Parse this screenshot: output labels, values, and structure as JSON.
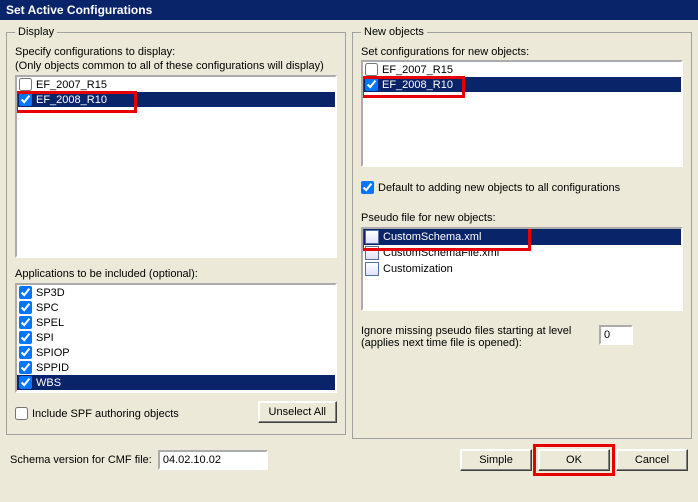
{
  "title": "Set Active Configurations",
  "display": {
    "legend": "Display",
    "specify_label": "Specify configurations to display:",
    "only_common_label": "(Only objects common to all of these configurations will display)",
    "items": [
      {
        "label": "EF_2007_R15",
        "checked": false,
        "selected": false
      },
      {
        "label": "EF_2008_R10",
        "checked": true,
        "selected": true
      }
    ],
    "apps_label": "Applications to be included (optional):",
    "apps": [
      {
        "label": "SP3D",
        "checked": true
      },
      {
        "label": "SPC",
        "checked": true
      },
      {
        "label": "SPEL",
        "checked": true
      },
      {
        "label": "SPI",
        "checked": true
      },
      {
        "label": "SPIOP",
        "checked": true
      },
      {
        "label": "SPPID",
        "checked": true
      },
      {
        "label": "WBS",
        "checked": true,
        "selected": true
      }
    ],
    "include_spf_label": "Include SPF authoring objects",
    "include_spf_checked": false,
    "unselect_all": "Unselect All"
  },
  "newobjects": {
    "legend": "New objects",
    "set_label": "Set configurations for new objects:",
    "items": [
      {
        "label": "EF_2007_R15",
        "checked": false,
        "selected": false
      },
      {
        "label": "EF_2008_R10",
        "checked": true,
        "selected": true
      }
    ],
    "default_add_label": "Default to adding new objects to all configurations",
    "default_add_checked": true,
    "pseudo_label": "Pseudo file for new objects:",
    "pseudo_items": [
      {
        "label": "CustomSchema.xml",
        "selected": true
      },
      {
        "label": "CustomSchemaFile.xml",
        "selected": false
      },
      {
        "label": "Customization",
        "selected": false
      }
    ],
    "ignore_label": "Ignore missing pseudo files starting at level (applies next time file is opened):",
    "ignore_value": "0"
  },
  "footer": {
    "schema_label": "Schema version for CMF file:",
    "schema_value": "04.02.10.02",
    "simple": "Simple",
    "ok": "OK",
    "cancel": "Cancel"
  }
}
